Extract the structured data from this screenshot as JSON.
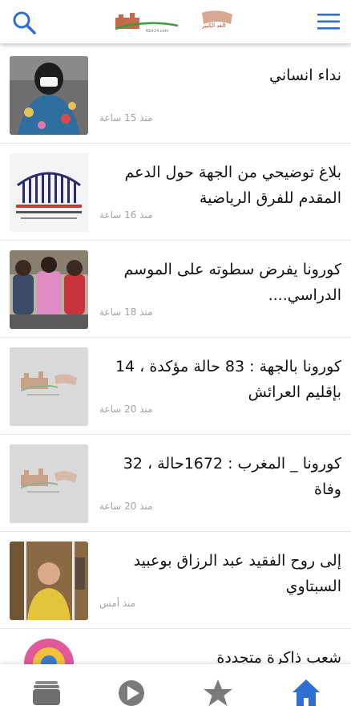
{
  "header": {
    "logo_text": "الغد الكبير",
    "logo_url": "Kbir24.com",
    "icons": {
      "search": "search-icon",
      "menu": "hamburger-menu-icon"
    }
  },
  "articles": [
    {
      "title": "نداء انساني",
      "time": "منذ 15 ساعة",
      "thumb": "photo"
    },
    {
      "title": "بلاغ توضيحي من الجهة حول الدعم المقدم للفرق الرياضية",
      "time": "منذ 16 ساعة",
      "thumb": "photo"
    },
    {
      "title": "كورونا يفرض سطوته على الموسم الدراسي....",
      "time": "منذ 18 ساعة",
      "thumb": "photo"
    },
    {
      "title": "كورونا بالجهة : 83 حالة مؤكدة ، 14 بإقليم العرائش",
      "time": "منذ 20 ساعة",
      "thumb": "logo-placeholder"
    },
    {
      "title": "كورونا _ المغرب : 1672حالة ، 32 وفاة",
      "time": "منذ 20 ساعة",
      "thumb": "logo-placeholder"
    },
    {
      "title": "إلى روح الفقيد عبد الرزاق بوعبيد السبتاوي",
      "time": "منذ أمس",
      "thumb": "photo"
    },
    {
      "title": "شعب ذاكرة متجددة",
      "time": "",
      "thumb": "photo"
    }
  ],
  "bottom_nav": [
    {
      "icon": "stack-icon",
      "active": false
    },
    {
      "icon": "play-icon",
      "active": false
    },
    {
      "icon": "star-icon",
      "active": false
    },
    {
      "icon": "home-icon",
      "active": true
    }
  ],
  "colors": {
    "accent": "#2f6fd1",
    "inactive": "#7a7a7a",
    "text": "#111111",
    "muted": "#a3a3a3"
  }
}
